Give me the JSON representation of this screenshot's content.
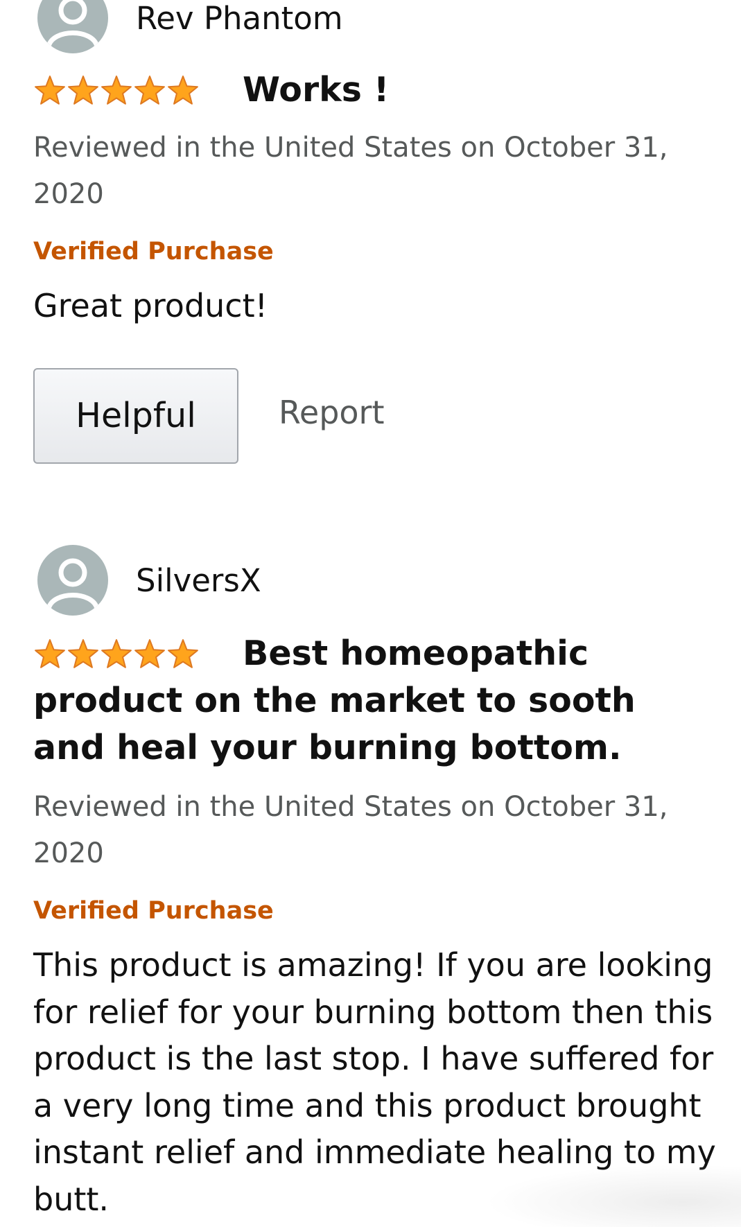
{
  "reviews": [
    {
      "reviewer": "Rev Phantom",
      "rating": 5,
      "rating_max": 5,
      "title": "Works !",
      "date": "Reviewed in the United States on October 31, 2020",
      "verified": "Verified Purchase",
      "body": "Great product!",
      "helpful_label": "Helpful",
      "report_label": "Report"
    },
    {
      "reviewer": "SilversX",
      "rating": 5,
      "rating_max": 5,
      "title": "Best homeopathic product on the market to sooth and heal your burning bottom.",
      "date": "Reviewed in the United States on October 31, 2020",
      "verified": "Verified Purchase",
      "body": "This product is amazing! If you are looking for relief for your burning bottom then this product is the last stop. I have suffered for a very long time and this product brought instant relief and immediate healing to my butt."
    }
  ],
  "icons": {
    "avatar": "person-silhouette-icon",
    "star": "star-icon"
  },
  "colors": {
    "star_fill": "#ffa41c",
    "star_stroke": "#de7921",
    "verified": "#c45500",
    "meta_text": "#565959",
    "avatar_bg": "#aab7b8"
  }
}
